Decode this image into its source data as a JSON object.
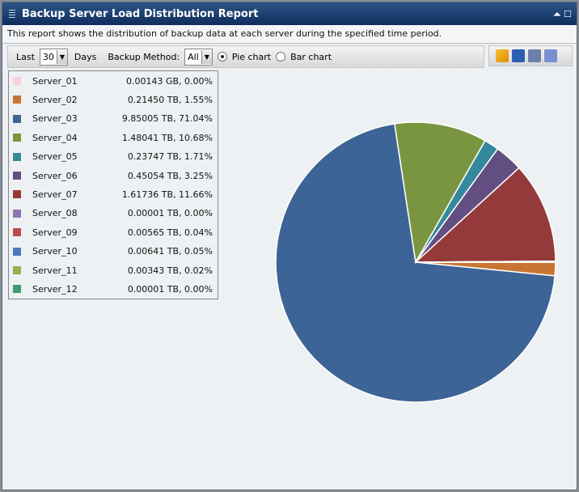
{
  "window": {
    "title": "Backup Server Load Distribution Report",
    "description": "This report shows the distribution of backup data at each server during the specified time period."
  },
  "toolbar": {
    "last_label": "Last",
    "days_value": "30",
    "days_label": "Days",
    "method_label": "Backup Method:",
    "method_value": "All",
    "pie_label": "Pie chart",
    "bar_label": "Bar chart",
    "selected_chart": "pie"
  },
  "chart_data": {
    "type": "pie",
    "start_angle_deg": 0,
    "direction": "clockwise",
    "legend_position": "left",
    "slices": [
      {
        "name": "Server_01",
        "label": "0.00143 GB, 0.00%",
        "percent": 0.0,
        "color": "#f7d3da"
      },
      {
        "name": "Server_02",
        "label": "0.21450 TB, 1.55%",
        "percent": 1.55,
        "color": "#c87533"
      },
      {
        "name": "Server_03",
        "label": "9.85005 TB, 71.04%",
        "percent": 71.04,
        "color": "#3c6496"
      },
      {
        "name": "Server_04",
        "label": "1.48041 TB, 10.68%",
        "percent": 10.68,
        "color": "#7a9540"
      },
      {
        "name": "Server_05",
        "label": "0.23747 TB, 1.71%",
        "percent": 1.71,
        "color": "#36899c"
      },
      {
        "name": "Server_06",
        "label": "0.45054 TB, 3.25%",
        "percent": 3.25,
        "color": "#634e82"
      },
      {
        "name": "Server_07",
        "label": "1.61736 TB, 11.66%",
        "percent": 11.66,
        "color": "#943a3a"
      },
      {
        "name": "Server_08",
        "label": "0.00001 TB, 0.00%",
        "percent": 0.0,
        "color": "#9373b5"
      },
      {
        "name": "Server_09",
        "label": "0.00565 TB, 0.04%",
        "percent": 0.04,
        "color": "#b84a4a"
      },
      {
        "name": "Server_10",
        "label": "0.00641 TB, 0.05%",
        "percent": 0.05,
        "color": "#4a78b8"
      },
      {
        "name": "Server_11",
        "label": "0.00343 TB, 0.02%",
        "percent": 0.02,
        "color": "#96b050"
      },
      {
        "name": "Server_12",
        "label": "0.00001 TB, 0.00%",
        "percent": 0.0,
        "color": "#3e9a72"
      }
    ]
  }
}
